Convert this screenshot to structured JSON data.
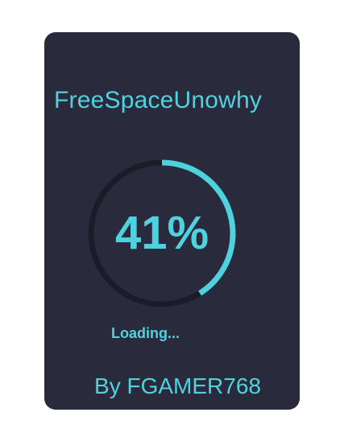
{
  "app": {
    "title": "FreeSpaceUnowhy"
  },
  "progress": {
    "percent_text": "41%",
    "value": 0.41,
    "status_text": "Loading...",
    "track_color": "#1c1c28",
    "fill_color": "#4fd2df"
  },
  "footer": {
    "credit": "By FGAMER768"
  },
  "colors": {
    "card_background": "#2a2a3d",
    "accent": "#4fd2df"
  }
}
